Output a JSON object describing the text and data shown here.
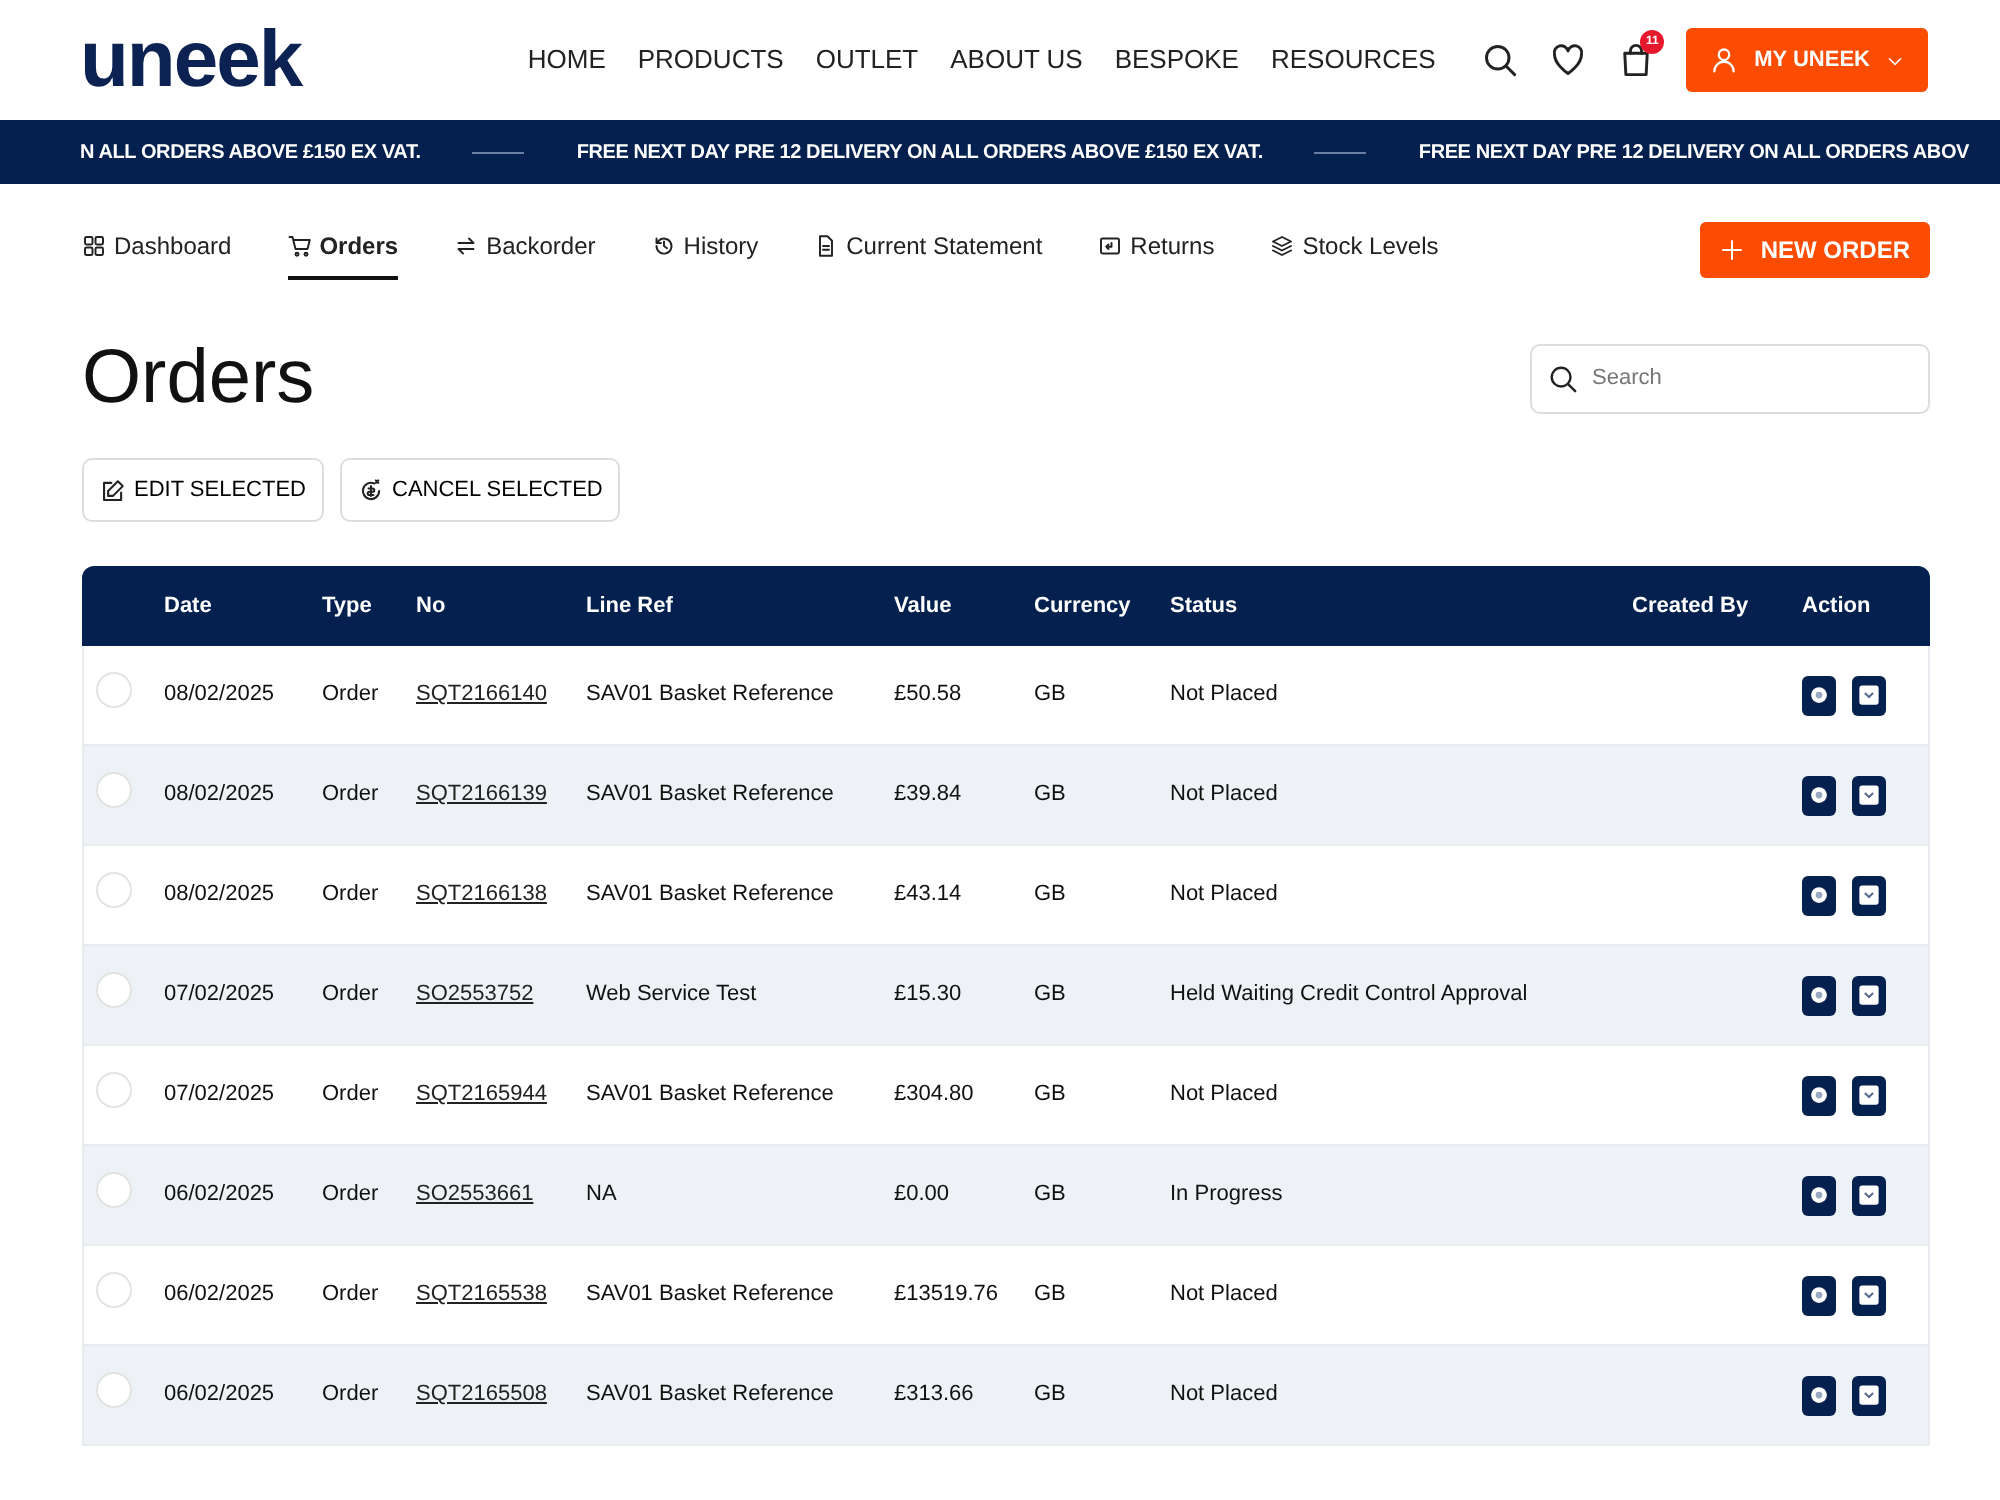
{
  "header": {
    "logo": "uneek",
    "nav": [
      {
        "label": "HOME"
      },
      {
        "label": "PRODUCTS"
      },
      {
        "label": "OUTLET"
      },
      {
        "label": "ABOUT US"
      },
      {
        "label": "BESPOKE"
      },
      {
        "label": "RESOURCES"
      }
    ],
    "cart_count": "11",
    "account_button": "MY UNEEK"
  },
  "ticker": [
    "N ALL ORDERS ABOVE £150 EX VAT.",
    "FREE NEXT DAY PRE 12 DELIVERY ON ALL ORDERS ABOVE £150 EX VAT.",
    "FREE NEXT DAY PRE 12 DELIVERY ON ALL ORDERS ABOV"
  ],
  "tabs": [
    {
      "label": "Dashboard",
      "selected": false
    },
    {
      "label": "Orders",
      "selected": true
    },
    {
      "label": "Backorder",
      "selected": false
    },
    {
      "label": "History",
      "selected": false
    },
    {
      "label": "Current Statement",
      "selected": false
    },
    {
      "label": "Returns",
      "selected": false
    },
    {
      "label": "Stock Levels",
      "selected": false
    }
  ],
  "new_order_button": "NEW ORDER",
  "page_title": "Orders",
  "search": {
    "placeholder": "Search"
  },
  "actions": [
    {
      "label": "EDIT SELECTED"
    },
    {
      "label": "CANCEL SELECTED"
    }
  ],
  "table": {
    "columns": [
      "Date",
      "Type",
      "No",
      "Line Ref",
      "Value",
      "Currency",
      "Status",
      "Created By",
      "Action"
    ],
    "rows": [
      {
        "selected": false,
        "date": "08/02/2025",
        "type": "Order",
        "no": "SQT2166140",
        "line_ref": "SAV01 Basket Reference",
        "value": "£50.58",
        "currency": "GB",
        "status": "Not Placed"
      },
      {
        "selected": false,
        "date": "08/02/2025",
        "type": "Order",
        "no": "SQT2166139",
        "line_ref": "SAV01 Basket Reference",
        "value": "£39.84",
        "currency": "GB",
        "status": "Not Placed"
      },
      {
        "selected": false,
        "date": "08/02/2025",
        "type": "Order",
        "no": "SQT2166138",
        "line_ref": "SAV01 Basket Reference",
        "value": "£43.14",
        "currency": "GB",
        "status": "Not Placed"
      },
      {
        "selected": false,
        "date": "07/02/2025",
        "type": "Order",
        "no": "SO2553752",
        "line_ref": "Web Service Test",
        "value": "£15.30",
        "currency": "GB",
        "status": "Held Waiting Credit Control Approval"
      },
      {
        "selected": false,
        "date": "07/02/2025",
        "type": "Order",
        "no": "SQT2165944",
        "line_ref": "SAV01 Basket Reference",
        "value": "£304.80",
        "currency": "GB",
        "status": "Not Placed"
      },
      {
        "selected": false,
        "date": "06/02/2025",
        "type": "Order",
        "no": "SO2553661",
        "line_ref": "NA",
        "value": "£0.00",
        "currency": "GB",
        "status": "In Progress"
      },
      {
        "selected": false,
        "date": "06/02/2025",
        "type": "Order",
        "no": "SQT2165538",
        "line_ref": "SAV01 Basket Reference",
        "value": "£13519.76",
        "currency": "GB",
        "status": "Not Placed"
      },
      {
        "selected": false,
        "date": "06/02/2025",
        "type": "Order",
        "no": "SQT2165508",
        "line_ref": "SAV01 Basket Reference",
        "value": "£313.66",
        "currency": "GB",
        "status": "Not Placed"
      }
    ]
  }
}
